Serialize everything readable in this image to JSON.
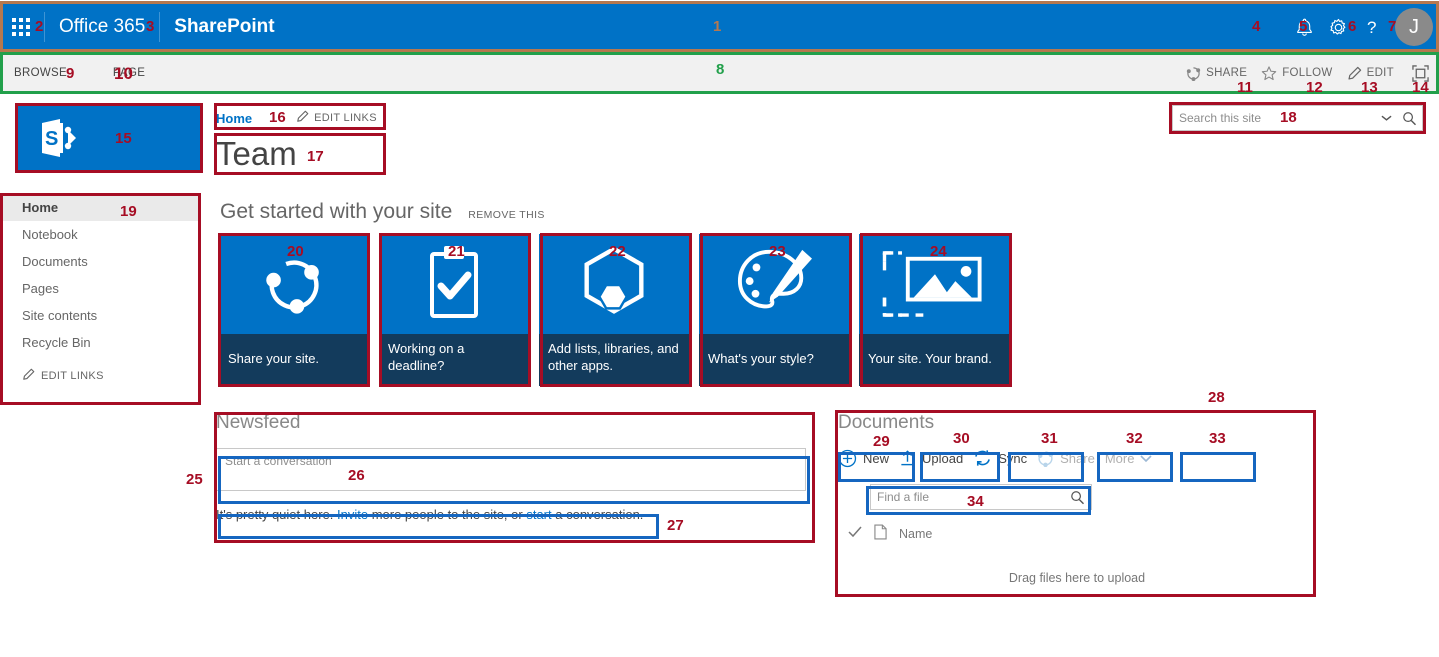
{
  "suite_bar": {
    "app_launcher_icon": "waffle-grid-icon",
    "brand": "Office 365",
    "app_name": "SharePoint",
    "notifications_icon": "bell-icon",
    "settings_icon": "gear-icon",
    "help_icon": "question-mark-icon",
    "avatar_initial": "J",
    "background": "#0072c6"
  },
  "ribbon": {
    "tabs": [
      {
        "label": "BROWSE"
      },
      {
        "label": "PAGE"
      }
    ],
    "commands": [
      {
        "label": "SHARE",
        "icon": "share-icon"
      },
      {
        "label": "FOLLOW",
        "icon": "star-icon"
      },
      {
        "label": "EDIT",
        "icon": "pencil-icon"
      },
      {
        "label": "",
        "icon": "focus-on-content-icon"
      }
    ]
  },
  "site_logo": {
    "icon": "sharepoint-logo-icon"
  },
  "breadcrumb": {
    "home_label": "Home",
    "edit_links_label": "EDIT LINKS",
    "edit_links_icon": "pencil-icon"
  },
  "site_title": "Team",
  "search": {
    "placeholder": "Search this site",
    "value": "",
    "dropdown_icon": "chevron-down-icon",
    "search_icon": "magnifier-icon"
  },
  "quick_launch": {
    "items": [
      {
        "label": "Home",
        "selected": true
      },
      {
        "label": "Notebook",
        "selected": false
      },
      {
        "label": "Documents",
        "selected": false
      },
      {
        "label": "Pages",
        "selected": false
      },
      {
        "label": "Site contents",
        "selected": false
      },
      {
        "label": "Recycle Bin",
        "selected": false
      }
    ],
    "edit_links_label": "EDIT LINKS",
    "edit_links_icon": "pencil-icon"
  },
  "get_started": {
    "title": "Get started with your site",
    "remove_label": "REMOVE THIS",
    "tiles": [
      {
        "caption": "Share your site.",
        "icon": "share-people-icon"
      },
      {
        "caption": "Working on a deadline?",
        "icon": "clipboard-check-icon"
      },
      {
        "caption": "Add lists, libraries, and other apps.",
        "icon": "hexagon-apps-icon"
      },
      {
        "caption": "What's your style?",
        "icon": "paint-palette-icon"
      },
      {
        "caption": "Your site. Your brand.",
        "icon": "image-placeholder-icon"
      }
    ]
  },
  "newsfeed": {
    "title": "Newsfeed",
    "composer_placeholder": "Start a conversation",
    "empty_text_1": "It's pretty quiet here. ",
    "empty_link_1": "Invite",
    "empty_text_2": " more people to the site, or ",
    "empty_link_2": "start",
    "empty_text_3": " a conversation."
  },
  "documents": {
    "title": "Documents",
    "buttons": [
      {
        "label": "New",
        "icon": "plus-circle-icon",
        "disabled": false
      },
      {
        "label": "Upload",
        "icon": "upload-arrow-icon",
        "disabled": false
      },
      {
        "label": "Sync",
        "icon": "sync-icon",
        "disabled": false
      },
      {
        "label": "Share",
        "icon": "share-icon",
        "disabled": true
      },
      {
        "label": "More",
        "icon": "chevron-down-icon",
        "disabled": true
      }
    ],
    "find_placeholder": "Find a file",
    "find_value": "",
    "find_icon": "magnifier-icon",
    "column_check_icon": "checkmark-icon",
    "column_type_icon": "document-icon",
    "column_name": "Name",
    "drop_hint": "Drag files here to upload"
  },
  "annotations": {
    "colors": {
      "red": "#a60d24",
      "blue": "#1566c0",
      "green": "#22a04b",
      "brown": "#b5784f"
    },
    "numbers": [
      "1",
      "2",
      "3",
      "4",
      "5",
      "6",
      "7",
      "8",
      "9",
      "10",
      "11",
      "12",
      "13",
      "14",
      "15",
      "16",
      "17",
      "18",
      "19",
      "20",
      "21",
      "22",
      "23",
      "24",
      "25",
      "26",
      "27",
      "28",
      "29",
      "30",
      "31",
      "32",
      "33",
      "34"
    ]
  }
}
